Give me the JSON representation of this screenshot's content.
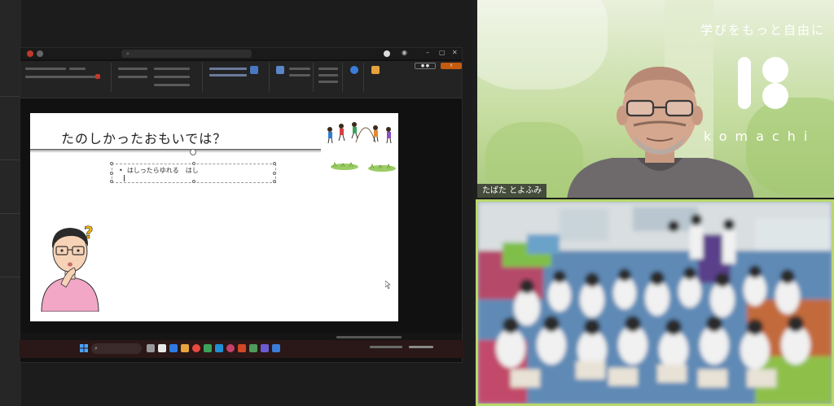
{
  "slide": {
    "title": "たのしかったおもいでは？",
    "textbox_bullet": "•",
    "textbox_text": "はしったらゆれる　はし"
  },
  "presenter_panel": {
    "brand_tagline": "学びをもっと自由に",
    "brand_name": "komachi",
    "participant_name": "たばた とよふみ"
  },
  "colors": {
    "brand_text": "#ffffff",
    "speaking_border": "#b7d86a",
    "share_button": "#c55a11",
    "taskbar": "#2a1717"
  },
  "icons": [
    "search-icon",
    "windows-start-icon",
    "record-icon",
    "share-icon",
    "question-mark-icon"
  ]
}
